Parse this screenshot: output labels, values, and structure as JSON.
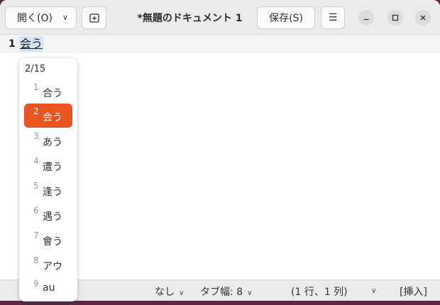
{
  "header": {
    "open_label": "開く(O)",
    "open_chevron": "∨",
    "title": "*無題のドキュメント 1",
    "save_label": "保存(S)",
    "menu_glyph": "☰",
    "newtab_glyph": "⊞",
    "window_controls": {
      "minimize": "—",
      "maximize": "□",
      "close": "✕"
    }
  },
  "editor": {
    "line_number": "1",
    "preedit_text": "会う"
  },
  "candidates": {
    "page": "2/15",
    "items": [
      {
        "num": "1",
        "text": "合う"
      },
      {
        "num": "2",
        "text": "会う"
      },
      {
        "num": "3",
        "text": "あう"
      },
      {
        "num": "4",
        "text": "遭う"
      },
      {
        "num": "5",
        "text": "逢う"
      },
      {
        "num": "6",
        "text": "遇う"
      },
      {
        "num": "7",
        "text": "會う"
      },
      {
        "num": "8",
        "text": "アウ"
      },
      {
        "num": "9",
        "text": "au"
      }
    ],
    "selected_index": 1,
    "accent_color": "#e95420"
  },
  "statusbar": {
    "language": "なし",
    "tab_width": "タブ幅: 8",
    "position": "(1 行、1 列)",
    "mode": "[挿入]",
    "chevron": "∨"
  }
}
